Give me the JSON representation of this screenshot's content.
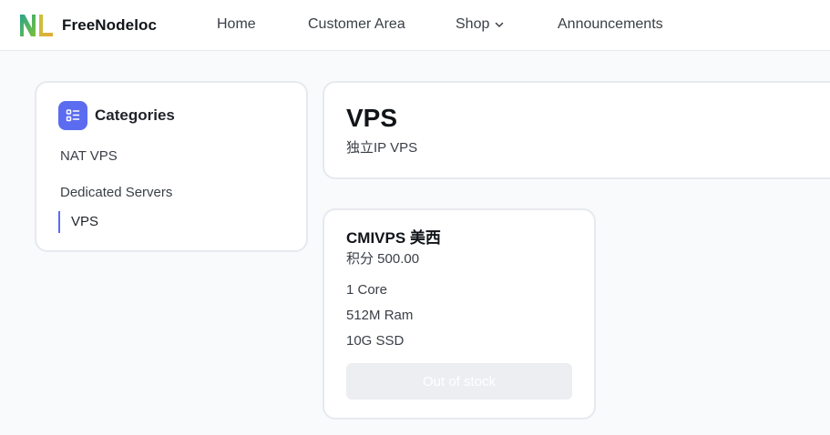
{
  "brand": {
    "name": "FreeNodeloc",
    "logo_text": "NL"
  },
  "nav": {
    "home": "Home",
    "customer_area": "Customer Area",
    "shop": "Shop",
    "announcements": "Announcements"
  },
  "categories": {
    "title": "Categories",
    "items": [
      "NAT VPS",
      "Dedicated Servers",
      "VPS"
    ],
    "active": "VPS"
  },
  "page_header": {
    "title": "VPS",
    "subtitle": "独立IP VPS"
  },
  "product": {
    "name": "CMIVPS 美西",
    "price": "积分 500.00",
    "features": [
      "1 Core",
      "512M Ram",
      "10G SSD"
    ],
    "button_label": "Out of stock"
  },
  "colors": {
    "accent": "#5b6cf0",
    "disabled_button": "#eceef1",
    "page_bg": "#f9fafc"
  }
}
